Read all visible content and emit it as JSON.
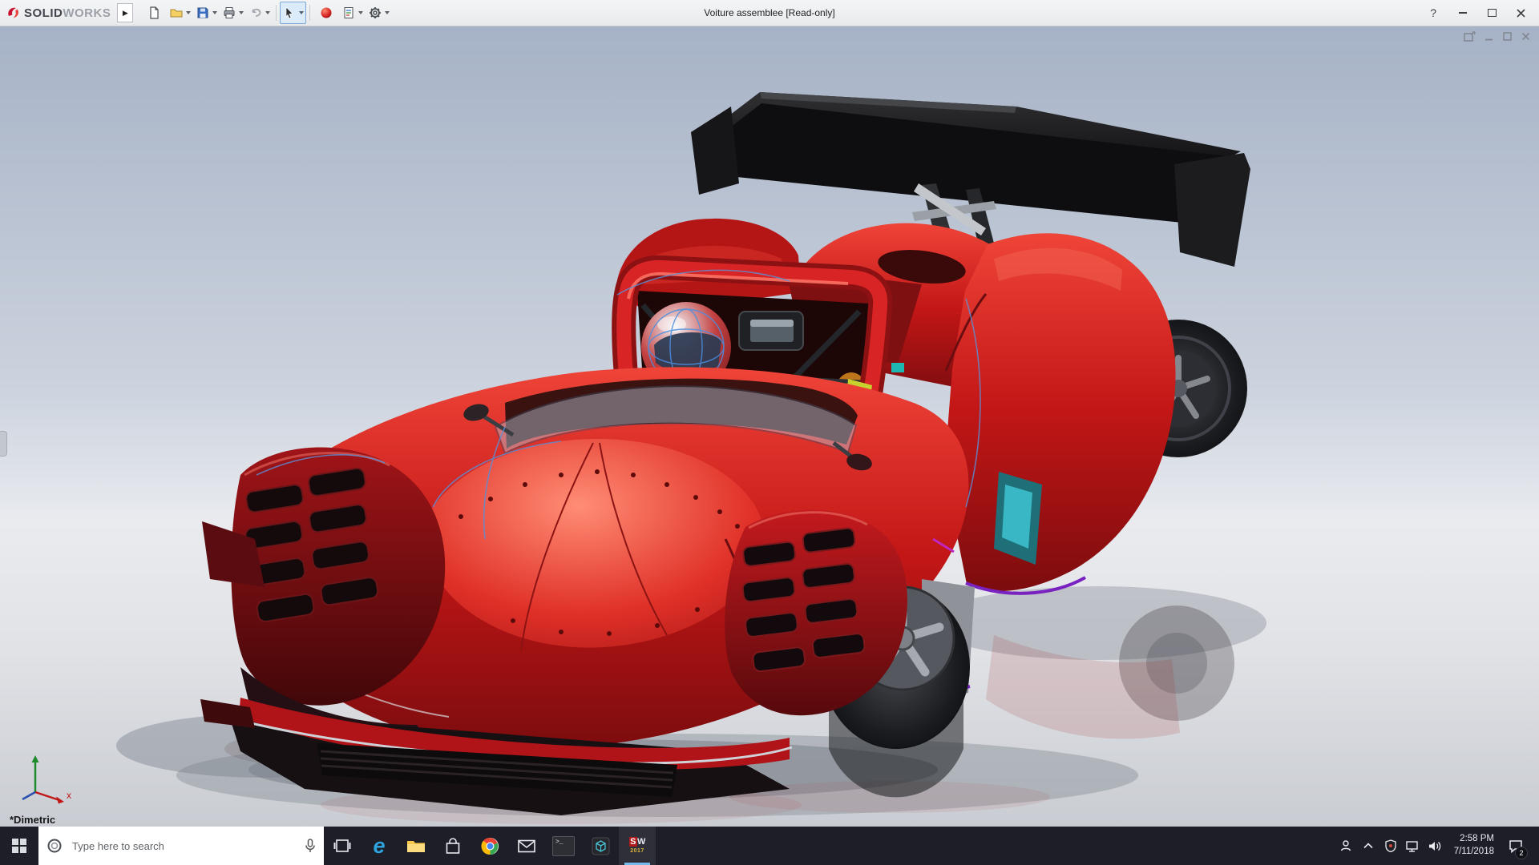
{
  "titlebar": {
    "logo": {
      "prefix": "SOLID",
      "suffix": "WORKS"
    },
    "flyout_glyph": "▶",
    "document_title": "Voiture assemblee [Read-only]",
    "help_glyph": "?",
    "toolbar": [
      {
        "name": "new-document"
      },
      {
        "name": "open-document"
      },
      {
        "name": "save"
      },
      {
        "name": "print"
      },
      {
        "name": "undo"
      },
      {
        "name": "select"
      },
      {
        "name": "appearances"
      },
      {
        "name": "view-settings"
      },
      {
        "name": "options"
      }
    ]
  },
  "viewport": {
    "view_orientation_label": "*Dimetric",
    "triad": {
      "x_label": "x"
    },
    "model": {
      "name": "Voiture assemblee",
      "body_color": "#d32222",
      "wing_color": "#101010",
      "wheel_color": "#1a1b1e",
      "edge_highlight_color": "#5b8fd6"
    }
  },
  "taskbar": {
    "search": {
      "placeholder": "Type here to search"
    },
    "apps": [
      {
        "name": "task-view"
      },
      {
        "name": "edge",
        "glyph": "e"
      },
      {
        "name": "file-explorer"
      },
      {
        "name": "store"
      },
      {
        "name": "chrome"
      },
      {
        "name": "mail"
      },
      {
        "name": "command-prompt",
        "glyph": ">_"
      },
      {
        "name": "edrawings"
      },
      {
        "name": "solidworks-2017",
        "label_s": "S",
        "label_w": "W",
        "sublabel": "2017",
        "active": true
      }
    ],
    "tray": {
      "time": "2:58 PM",
      "date": "7/11/2018",
      "badge": "2"
    }
  }
}
